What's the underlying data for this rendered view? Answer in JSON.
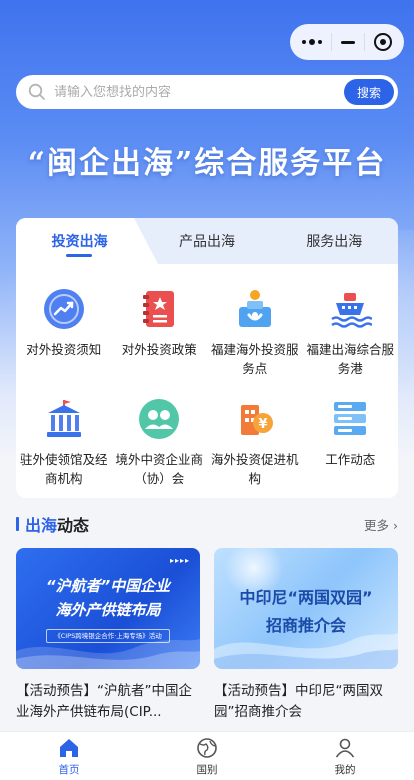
{
  "search": {
    "placeholder": "请输入您想找的内容",
    "button_label": "搜索"
  },
  "hero": {
    "title": "“闽企出海”综合服务平台"
  },
  "service_tabs": {
    "tabs": [
      {
        "label": "投资出海",
        "active": true
      },
      {
        "label": "产品出海",
        "active": false
      },
      {
        "label": "服务出海",
        "active": false
      }
    ],
    "items": [
      {
        "label": "对外投资须知",
        "icon": "trend-chart-icon"
      },
      {
        "label": "对外投资政策",
        "icon": "policy-book-icon"
      },
      {
        "label": "福建海外投资服务点",
        "icon": "service-point-icon"
      },
      {
        "label": "福建出海综合服务港",
        "icon": "ship-icon"
      },
      {
        "label": "驻外使领馆及经商机构",
        "icon": "embassy-icon"
      },
      {
        "label": "境外中资企业商（协）会",
        "icon": "association-icon"
      },
      {
        "label": "海外投资促进机构",
        "icon": "building-yuan-icon"
      },
      {
        "label": "工作动态",
        "icon": "server-list-icon"
      }
    ]
  },
  "news": {
    "title_part1": "出海",
    "title_part2": "动态",
    "more_label": "更多 ›",
    "cards": [
      {
        "image_title_line1": "“沪航者”中国企业",
        "image_title_line2": "海外产供链布局",
        "image_subtitle": "《CIPS跨境银企合作·上海专场》活动",
        "text": "【活动预告】“沪航者”中国企业海外产供链布局(CIP..."
      },
      {
        "image_title_line1": "中印尼“两国双园”",
        "image_title_line2": "招商推介会",
        "text": "【活动预告】中印尼“两国双园”招商推介会"
      }
    ]
  },
  "tabbar": {
    "items": [
      {
        "label": "首页",
        "icon": "home-icon",
        "active": true
      },
      {
        "label": "国别",
        "icon": "globe-icon",
        "active": false
      },
      {
        "label": "我的",
        "icon": "user-icon",
        "active": false
      }
    ]
  },
  "colors": {
    "primary": "#2d63e6",
    "hero_top": "#3f73ee"
  }
}
